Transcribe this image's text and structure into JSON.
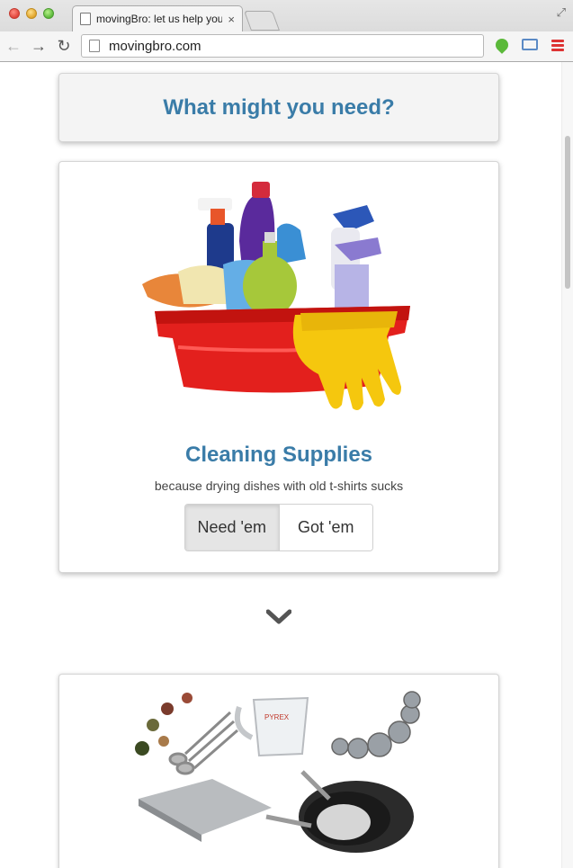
{
  "browser": {
    "tab_title": "movingBro: let us help you",
    "tab_close": "×",
    "url": "movingbro.com",
    "icons": [
      "back-arrow-icon",
      "forward-arrow-icon",
      "reload-icon",
      "page-icon",
      "extension-icon",
      "cast-icon",
      "menu-icon",
      "fullscreen-icon"
    ]
  },
  "page": {
    "heading": "What might you need?",
    "items": [
      {
        "title": "Cleaning Supplies",
        "subtitle": "because drying dishes with old t-shirts sucks",
        "need_label": "Need 'em",
        "got_label": "Got 'em",
        "selected": "need"
      }
    ],
    "next_icon": "chevron-down-icon",
    "colors": {
      "heading": "#3a7ca8",
      "header_bg": "#f4f4f4",
      "button_active_bg": "#e5e5e5"
    }
  }
}
